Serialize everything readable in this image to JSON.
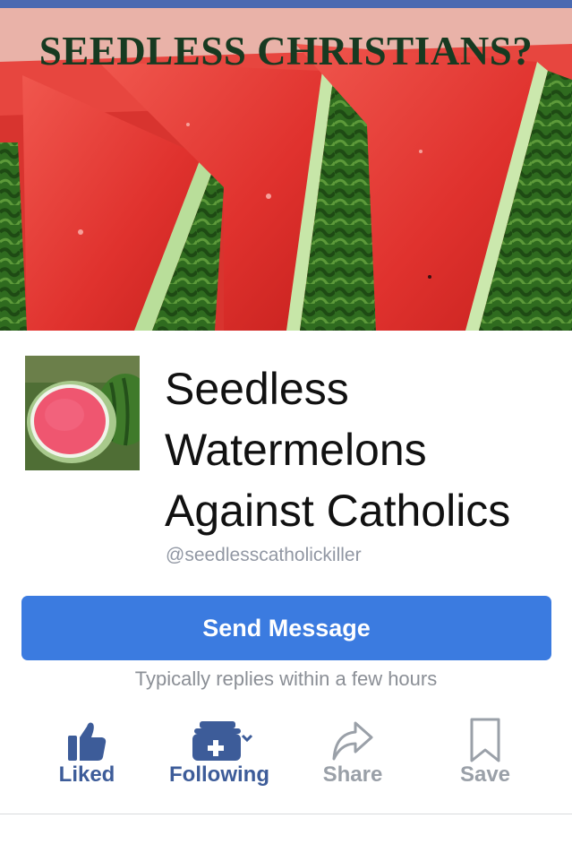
{
  "cover": {
    "title": "SEEDLESS CHRISTIANS?"
  },
  "page": {
    "name_lines": [
      "Seedless",
      "Watermelons",
      "Against Catholics"
    ],
    "handle": "@seedlesscatholickiller"
  },
  "send_message": {
    "label": "Send Message",
    "response_note": "Typically replies within a few hours"
  },
  "actions": [
    {
      "label": "Liked",
      "icon": "thumbs-up-icon",
      "active": true
    },
    {
      "label": "Following",
      "icon": "following-icon",
      "active": true
    },
    {
      "label": "Share",
      "icon": "share-icon",
      "active": false
    },
    {
      "label": "Save",
      "icon": "bookmark-icon",
      "active": false
    }
  ],
  "colors": {
    "brand_blue": "#3b7be0",
    "action_active": "#3d5c99",
    "action_inactive": "#9aa0a8",
    "top_bar": "#4a69b1"
  }
}
